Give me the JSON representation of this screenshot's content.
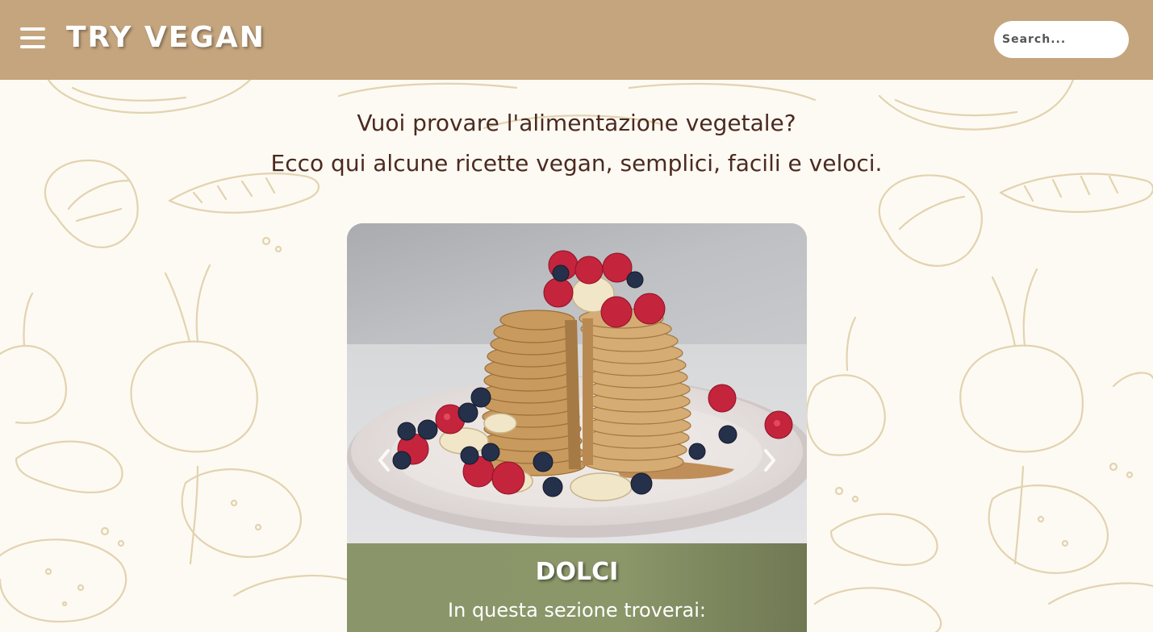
{
  "header": {
    "logo": "TRY VEGAN",
    "search_placeholder": "Search..."
  },
  "intro": {
    "line1": "Vuoi provare l'alimentazione vegetale?",
    "line2": "Ecco qui alcune ricette vegan, semplici, facili e veloci."
  },
  "carousel": {
    "slide": {
      "title": "DOLCI",
      "description": "In questa sezione troverai:"
    }
  },
  "colors": {
    "header_bg": "#c4a57e",
    "caption_bg": "#8b9669",
    "text_dark": "#4b2a20",
    "doodle": "#e2d3b0"
  },
  "icons": [
    "menu-icon",
    "chevron-left-icon",
    "chevron-right-icon"
  ]
}
